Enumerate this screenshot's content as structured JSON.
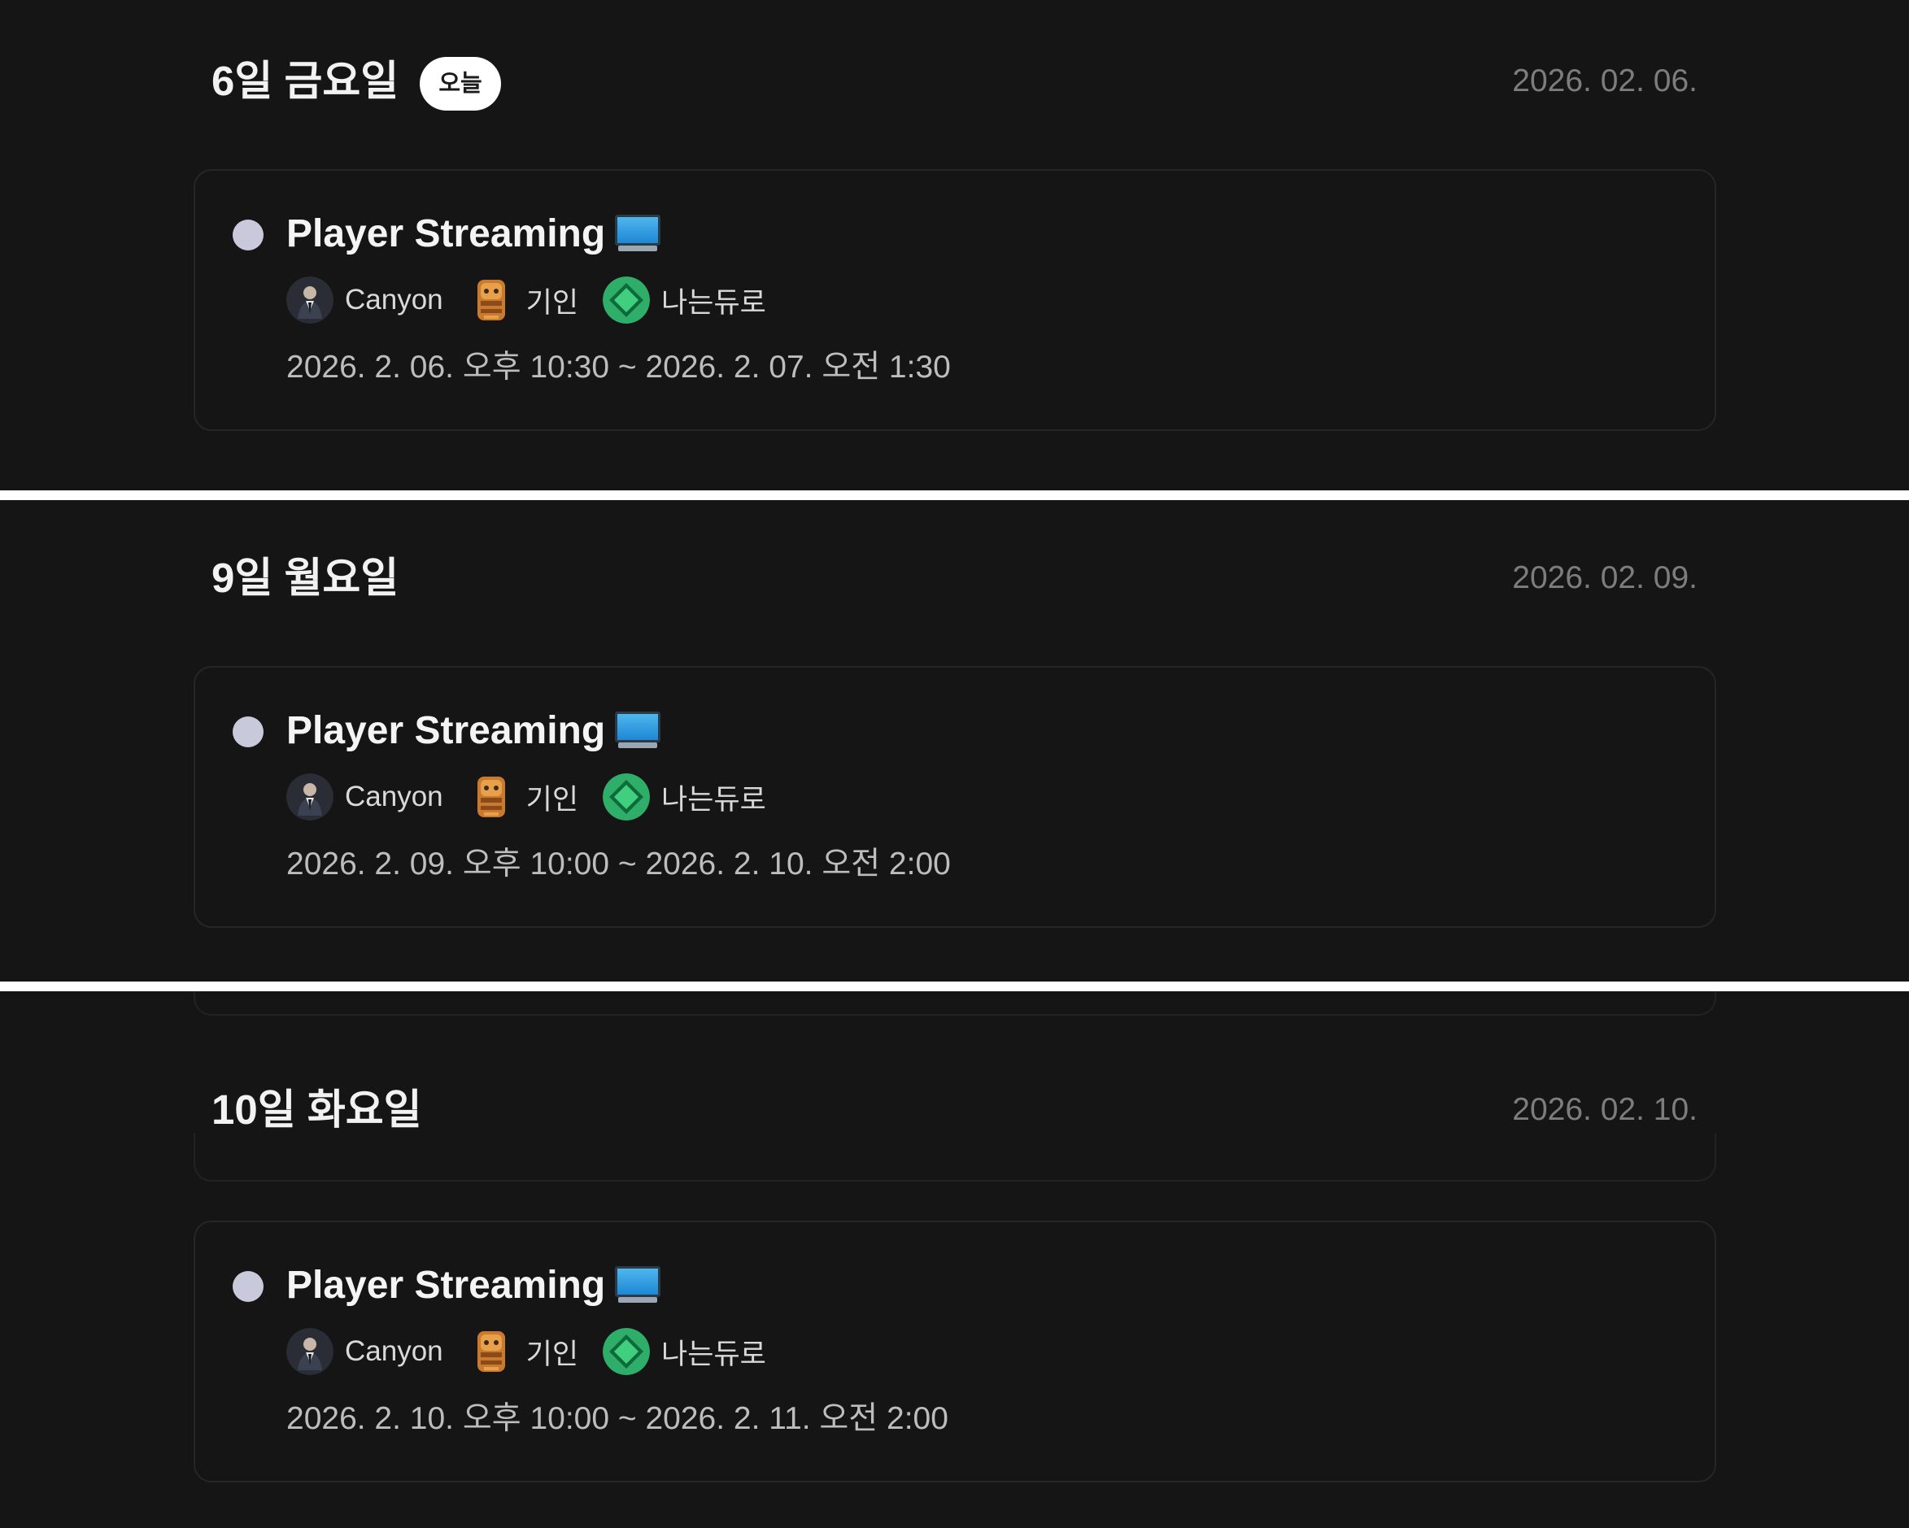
{
  "today_badge": "오늘",
  "days": [
    {
      "title": "6일 금요일",
      "date": "2026. 02. 06.",
      "is_today": true,
      "event": {
        "title": "Player Streaming",
        "icon": "monitor-icon",
        "participants": [
          {
            "name": "Canyon",
            "avatar": "canyon-avatar"
          },
          {
            "name": "기인",
            "avatar": "kiin-avatar"
          },
          {
            "name": "나는듀로",
            "avatar": "green-diamond-avatar"
          }
        ],
        "time": "2026. 2. 06. 오후 10:30 ~ 2026. 2. 07. 오전 1:30"
      }
    },
    {
      "title": "9일 월요일",
      "date": "2026. 02. 09.",
      "is_today": false,
      "event": {
        "title": "Player Streaming",
        "icon": "monitor-icon",
        "participants": [
          {
            "name": "Canyon",
            "avatar": "canyon-avatar"
          },
          {
            "name": "기인",
            "avatar": "kiin-avatar"
          },
          {
            "name": "나는듀로",
            "avatar": "green-diamond-avatar"
          }
        ],
        "time": "2026. 2. 09. 오후 10:00 ~ 2026. 2. 10. 오전 2:00"
      }
    },
    {
      "title": "10일 화요일",
      "date": "2026. 02. 10.",
      "is_today": false,
      "event": {
        "title": "Player Streaming",
        "icon": "monitor-icon",
        "participants": [
          {
            "name": "Canyon",
            "avatar": "canyon-avatar"
          },
          {
            "name": "기인",
            "avatar": "kiin-avatar"
          },
          {
            "name": "나는듀로",
            "avatar": "green-diamond-avatar"
          }
        ],
        "time": "2026. 2. 10. 오후 10:00 ~ 2026. 2. 11. 오전 2:00"
      }
    }
  ],
  "colors": {
    "background": "#151516",
    "card_border": "#262628",
    "status_dot": "#c9c9dc",
    "badge_bg": "#ffffff",
    "date_text": "#7d7d7d"
  }
}
